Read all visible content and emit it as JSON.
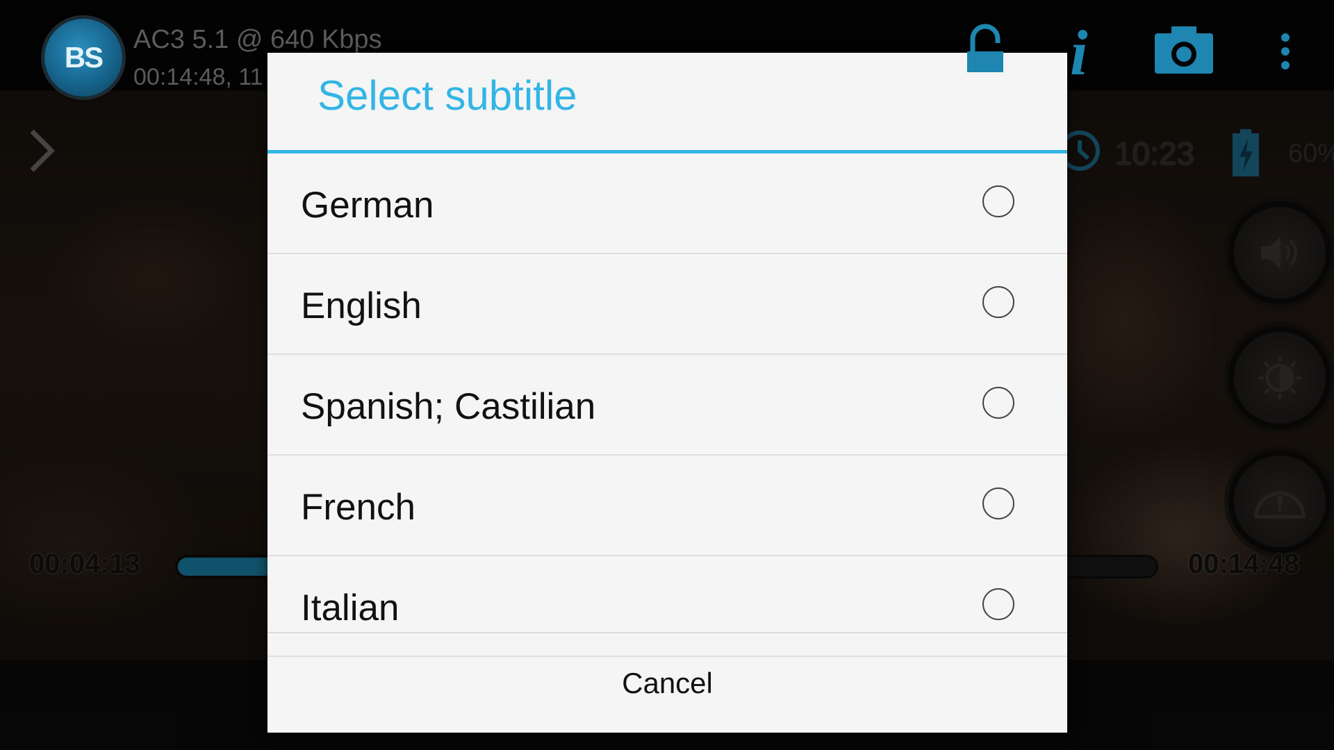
{
  "player": {
    "logo_text": "BS",
    "audio_info": "AC3 5.1 @ 640 Kbps",
    "time_info": "00:14:48, 11",
    "clock": "10:23",
    "battery": "60%",
    "elapsed": "00:04:13",
    "total": "00:14:48",
    "progress_fraction": 0.285
  },
  "dialog": {
    "title": "Select subtitle",
    "options": [
      {
        "label": "German",
        "selected": false
      },
      {
        "label": "English",
        "selected": false
      },
      {
        "label": "Spanish; Castilian",
        "selected": false
      },
      {
        "label": "French",
        "selected": false
      },
      {
        "label": "Italian",
        "selected": false
      }
    ],
    "cancel_label": "Cancel"
  },
  "colors": {
    "accent": "#33b5e5",
    "player_blue": "#1a7ea5",
    "dialog_bg": "#f5f5f5"
  },
  "icons": [
    "lock-icon",
    "info-icon",
    "camera-icon",
    "overflow-menu-icon",
    "chevron-right-icon",
    "clock-icon",
    "battery-charging-icon",
    "volume-icon",
    "brightness-icon",
    "speedometer-icon"
  ]
}
